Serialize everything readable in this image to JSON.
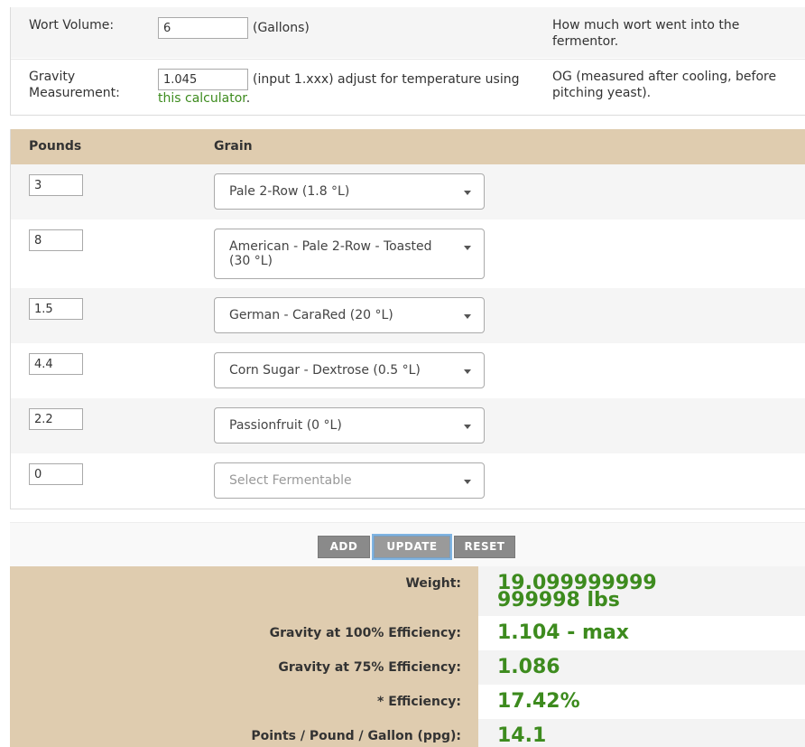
{
  "params": {
    "wort_volume": {
      "label": "Wort Volume:",
      "value": "6",
      "unit": "(Gallons)",
      "description": "How much wort went into the fermentor."
    },
    "gravity": {
      "label_line1": "Gravity",
      "label_line2": "Measurement:",
      "value": "1.045",
      "hint": "(input 1.xxx) adjust for temperature using",
      "link_text": "this calculator",
      "link_suffix": ".",
      "description": "OG (measured after cooling, before pitching yeast)."
    }
  },
  "grain_table": {
    "headers": {
      "pounds": "Pounds",
      "grain": "Grain"
    },
    "rows": [
      {
        "pounds": "3",
        "grain": "Pale 2-Row (1.8 °L)"
      },
      {
        "pounds": "8",
        "grain": "American - Pale 2-Row - Toasted (30 °L)"
      },
      {
        "pounds": "1.5",
        "grain": "German - CaraRed (20 °L)"
      },
      {
        "pounds": "4.4",
        "grain": "Corn Sugar - Dextrose (0.5 °L)"
      },
      {
        "pounds": "2.2",
        "grain": "Passionfruit (0 °L)"
      },
      {
        "pounds": "0",
        "grain": "Select Fermentable"
      }
    ]
  },
  "buttons": {
    "add": "ADD",
    "update": "UPDATE",
    "reset": "RESET"
  },
  "results": {
    "weight": {
      "label": "Weight:",
      "value": "19.099999999999998 lbs"
    },
    "gravity_100": {
      "label": "Gravity at 100% Efficiency:",
      "value": "1.104 - max"
    },
    "gravity_75": {
      "label": "Gravity at 75% Efficiency:",
      "value": "1.086"
    },
    "efficiency": {
      "label": "* Efficiency:",
      "value": "17.42%"
    },
    "ppg": {
      "label": "Points / Pound / Gallon (ppg):",
      "value": "14.1"
    }
  },
  "colors": {
    "header_tan": "#dfccaf",
    "result_green": "#3d8b1e",
    "button_gray": "#8a8a8a",
    "focus_blue": "#7fb4e2"
  }
}
